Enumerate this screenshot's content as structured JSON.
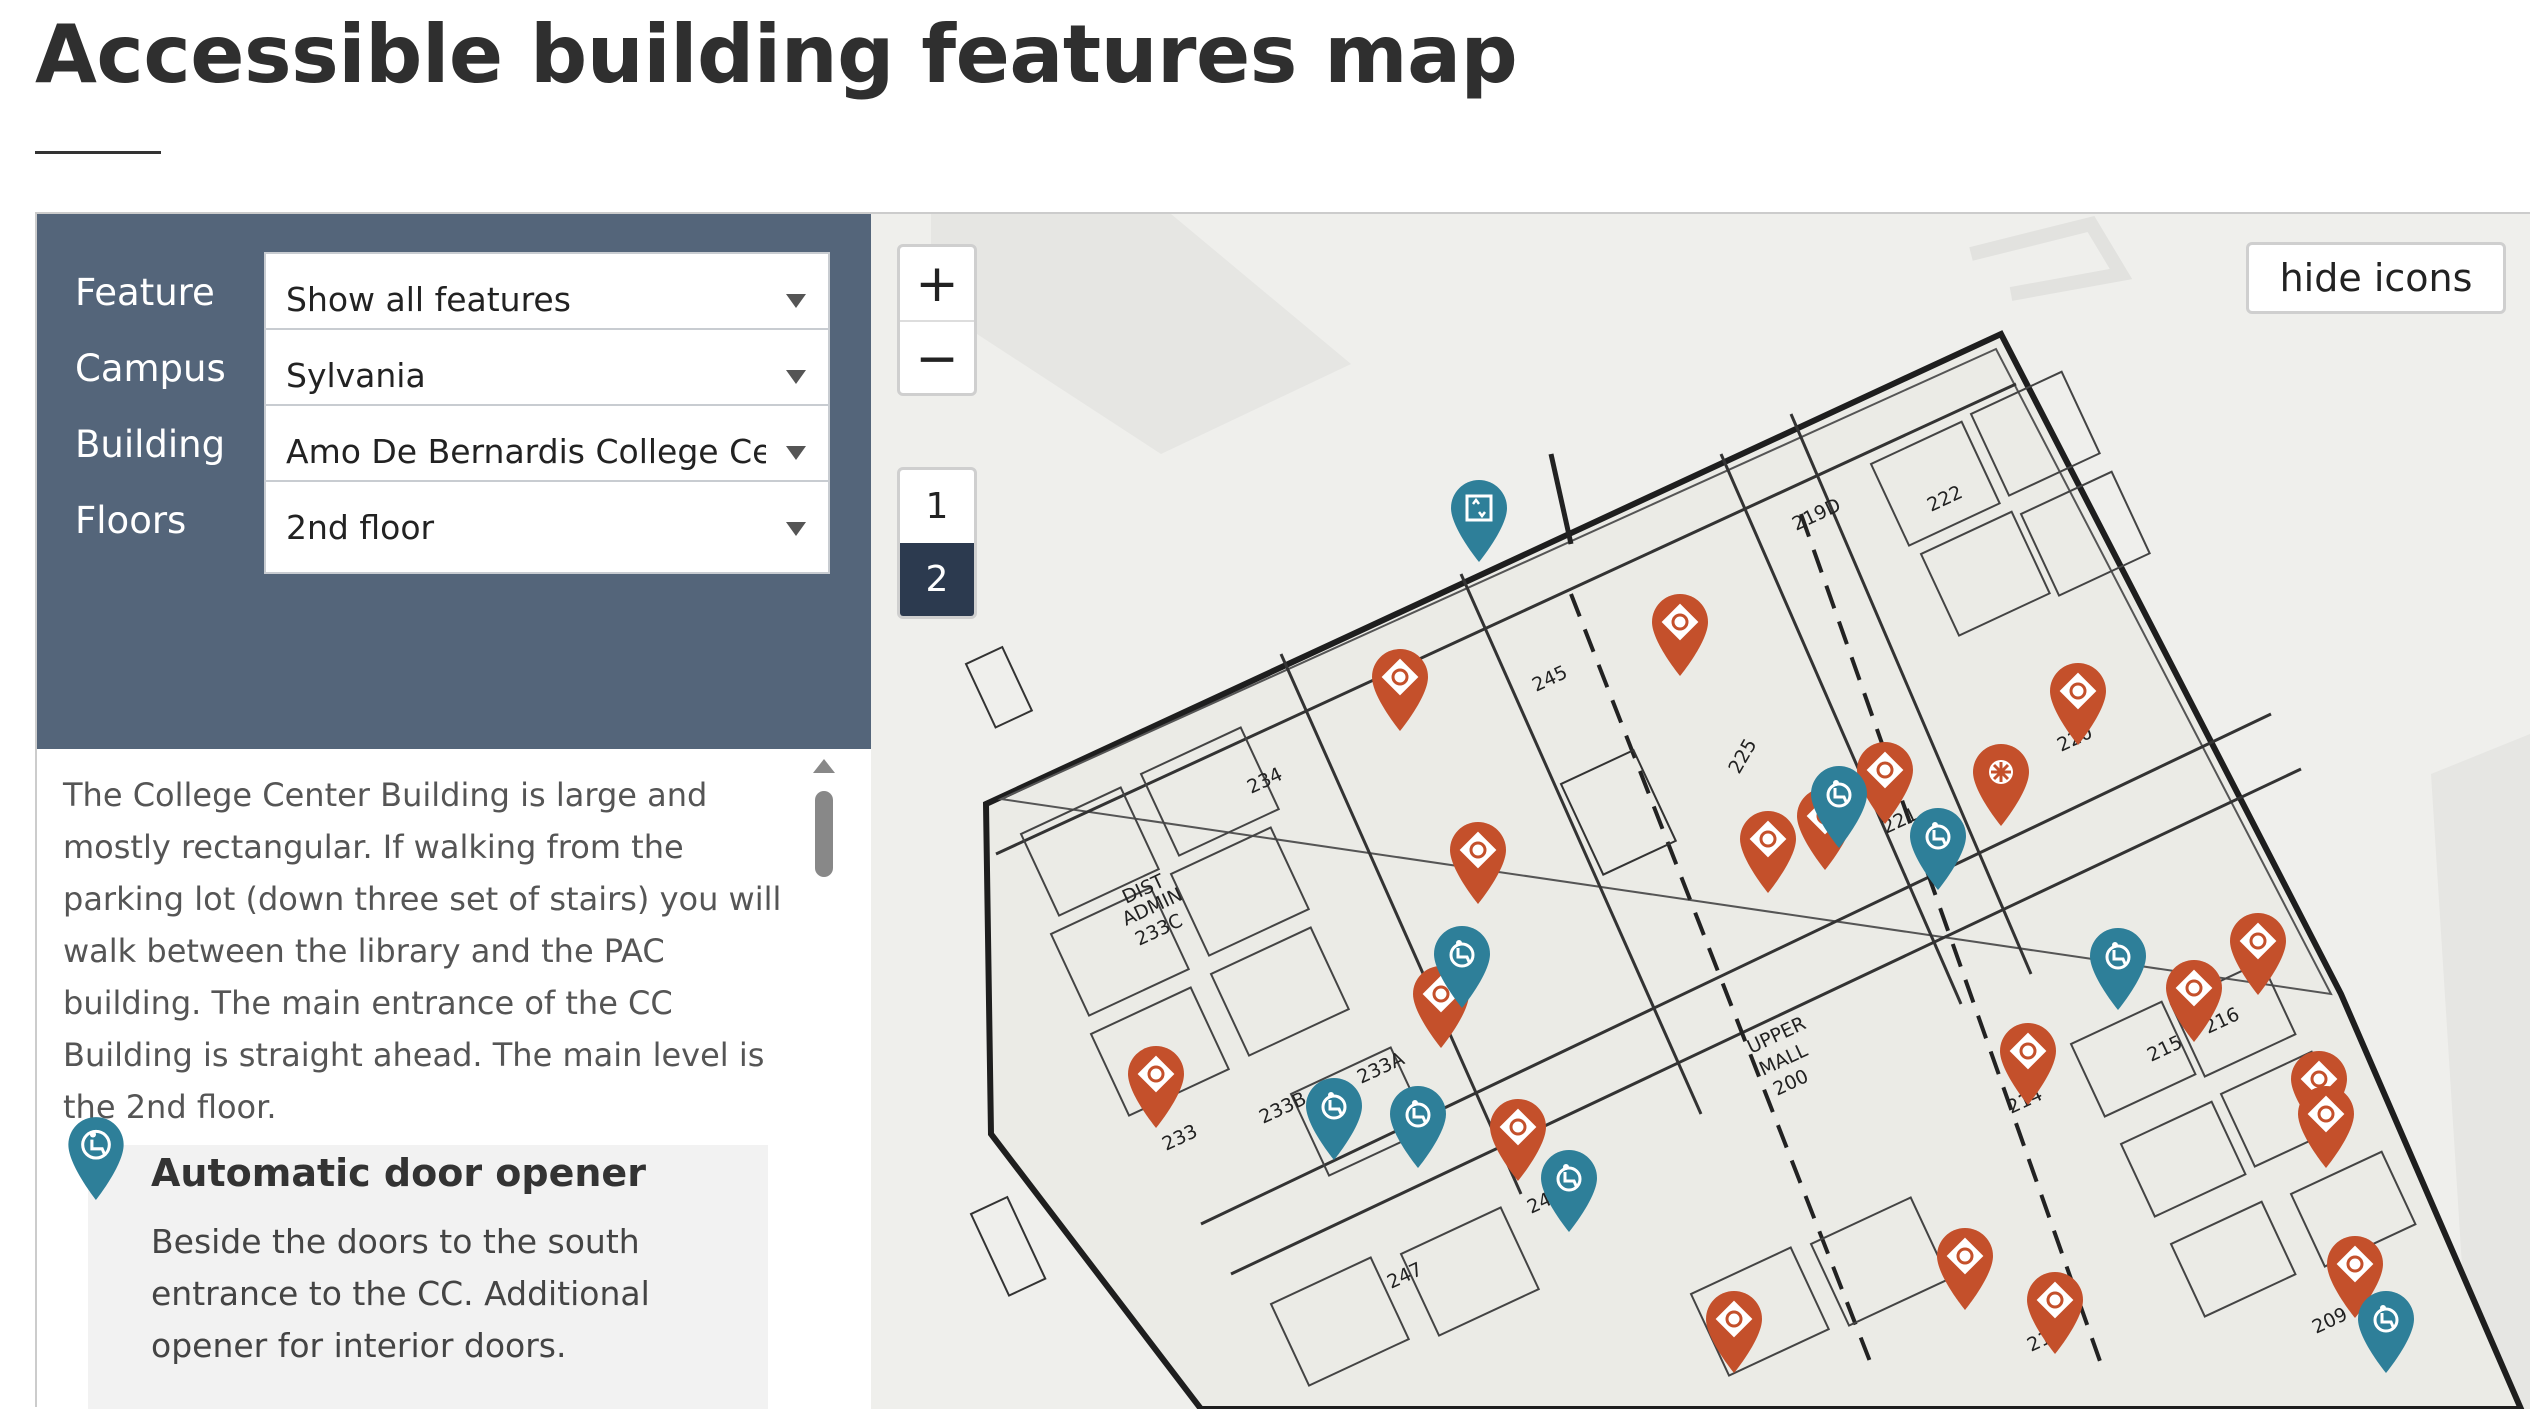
{
  "page": {
    "title": "Accessible building features map"
  },
  "controls": {
    "feature": {
      "label": "Feature",
      "value": "Show all features"
    },
    "campus": {
      "label": "Campus",
      "value": "Sylvania"
    },
    "building": {
      "label": "Building",
      "value": "Amo De Bernardis College Center"
    },
    "floors": {
      "label": "Floors",
      "value": "2nd floor"
    }
  },
  "description": "The College Center Building is large and mostly rectangular. If walking from the parking lot (down three set of stairs) you will walk between the library and the PAC building. The main entrance of the CC Building is straight ahead. The main level is the 2nd floor.",
  "feature_list": [
    {
      "icon": "wheelchair-icon",
      "title": "Automatic door opener",
      "text": "Beside the doors to the south entrance to the CC. Additional opener for interior doors."
    }
  ],
  "map": {
    "zoom_in": "+",
    "zoom_out": "−",
    "floors": [
      "1",
      "2"
    ],
    "active_floor": "2",
    "hide_icons_label": "hide icons",
    "room_labels": [
      "219D",
      "222",
      "245",
      "225",
      "221",
      "220",
      "234",
      "DIST",
      "ADMIN",
      "233C",
      "UPPER",
      "MALL",
      "200",
      "216",
      "215",
      "214",
      "233A",
      "233B",
      "233",
      "248",
      "247",
      "209",
      "212"
    ],
    "colors": {
      "orange_pin": "#c4502b",
      "blue_pin": "#2e7f99",
      "panel": "#54657a"
    }
  }
}
